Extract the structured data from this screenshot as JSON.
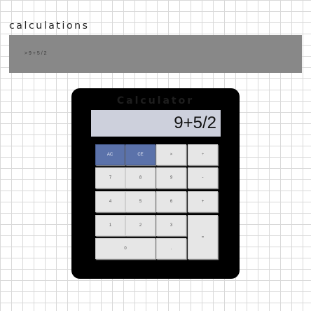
{
  "page": {
    "heading": "calculations"
  },
  "log": {
    "entries": [
      "> 9 + 5 / 2"
    ]
  },
  "calculator": {
    "title": "Calculator",
    "display": "9+5/2",
    "keys": {
      "ac": "AC",
      "ce": "CE",
      "multiply": "×",
      "divide": "÷",
      "seven": "7",
      "eight": "8",
      "nine": "9",
      "minus": "-",
      "four": "4",
      "five": "5",
      "six": "6",
      "plus": "+",
      "one": "1",
      "two": "2",
      "three": "3",
      "equals": "=",
      "zero": "0",
      "decimal": "."
    }
  },
  "colors": {
    "clear_keys": "#5b72aa",
    "calculator_body": "#000000",
    "display_background": "#cdd0dc",
    "log_panel": "#888888"
  }
}
